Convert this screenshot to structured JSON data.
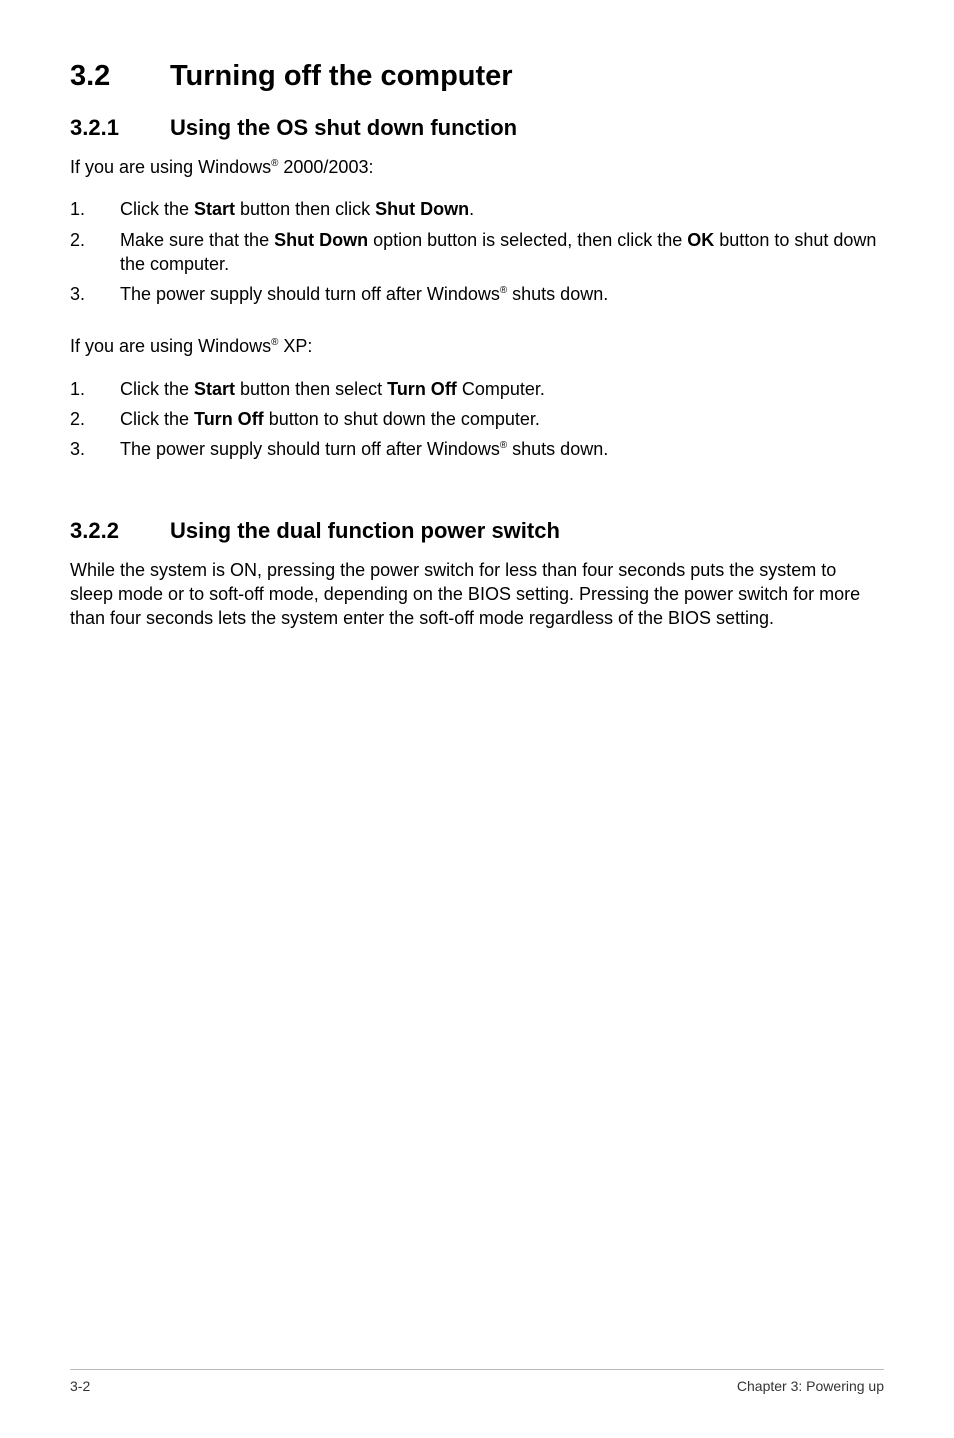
{
  "section": {
    "num": "3.2",
    "title": "Turning off the computer"
  },
  "sub1": {
    "num": "3.2.1",
    "title": "Using the OS shut down function",
    "intro_pre": "If you are using Windows",
    "intro_sup": "®",
    "intro_post": " 2000/2003:",
    "list": {
      "i1": {
        "num": "1.",
        "pre": "Click the ",
        "b1": "Start",
        "mid": " button then click ",
        "b2": "Shut Down",
        "post": "."
      },
      "i2": {
        "num": "2.",
        "pre": "Make sure that the ",
        "b1": "Shut Down",
        "mid": " option button is selected, then click the ",
        "b2": "OK",
        "post": " button to shut down the computer."
      },
      "i3": {
        "num": "3.",
        "pre": "The power supply should turn off after Windows",
        "sup": "®",
        "post": " shuts down."
      }
    },
    "intro2_pre": "If you are using Windows",
    "intro2_sup": "®",
    "intro2_post": " XP:",
    "list2": {
      "i1": {
        "num": "1.",
        "pre": "Click the ",
        "b1": "Start",
        "mid": " button then select ",
        "b2": "Turn Off",
        "post": " Computer."
      },
      "i2": {
        "num": "2.",
        "pre": "Click the ",
        "b1": "Turn Off",
        "post": " button to shut down the computer."
      },
      "i3": {
        "num": "3.",
        "pre": "The power supply should turn off after Windows",
        "sup": "®",
        "post": " shuts down."
      }
    }
  },
  "sub2": {
    "num": "3.2.2",
    "title": "Using the dual function power switch",
    "para": "While the system is ON, pressing the power switch for less than four seconds puts the system to sleep mode or to soft-off mode, depending on the BIOS setting. Pressing the power switch for more than four seconds lets the system enter the soft-off mode regardless of the BIOS setting."
  },
  "footer": {
    "left": "3-2",
    "right": "Chapter 3: Powering up"
  }
}
